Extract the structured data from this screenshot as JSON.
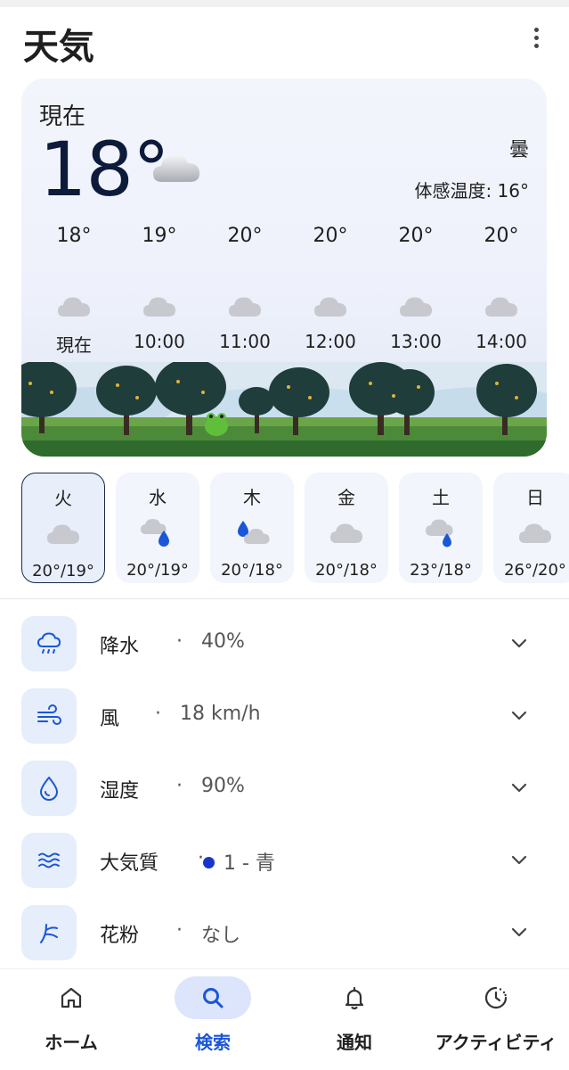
{
  "app": {
    "title": "天気"
  },
  "current": {
    "label": "現在",
    "temperature": "18°",
    "condition": "曇",
    "feels_like": "体感温度: 16°",
    "icon": "cloud-icon"
  },
  "hourly": [
    {
      "temp": "18°",
      "time": "現在",
      "icon": "cloud-icon"
    },
    {
      "temp": "19°",
      "time": "10:00",
      "icon": "cloud-icon"
    },
    {
      "temp": "20°",
      "time": "11:00",
      "icon": "cloud-icon"
    },
    {
      "temp": "20°",
      "time": "12:00",
      "icon": "cloud-icon"
    },
    {
      "temp": "20°",
      "time": "13:00",
      "icon": "cloud-icon"
    },
    {
      "temp": "20°",
      "time": "14:00",
      "icon": "cloud-icon"
    }
  ],
  "daily": [
    {
      "day": "火",
      "range": "20°/19°",
      "icon": "cloud-icon",
      "selected": true
    },
    {
      "day": "水",
      "range": "20°/19°",
      "icon": "cloud-rain-icon"
    },
    {
      "day": "木",
      "range": "20°/18°",
      "icon": "rain-cloud-icon"
    },
    {
      "day": "金",
      "range": "20°/18°",
      "icon": "cloud-icon"
    },
    {
      "day": "土",
      "range": "23°/18°",
      "icon": "cloud-rain-icon"
    },
    {
      "day": "日",
      "range": "26°/20°",
      "icon": "cloud-icon"
    }
  ],
  "details": {
    "dot": "·",
    "precipitation": {
      "label": "降水",
      "value": "40%",
      "icon": "rain-cloud-icon"
    },
    "wind": {
      "label": "風",
      "value": "18 km/h",
      "icon": "wind-icon"
    },
    "humidity": {
      "label": "湿度",
      "value": "90%",
      "icon": "droplet-icon"
    },
    "air_quality": {
      "label": "大気質",
      "value": "1 - 青",
      "icon": "air-waves-icon",
      "dot_color": "#1736c9"
    },
    "pollen": {
      "label": "花粉",
      "value": "なし",
      "icon": "pollen-icon"
    }
  },
  "bottom_nav": [
    {
      "label": "ホーム",
      "icon": "home-icon"
    },
    {
      "label": "検索",
      "icon": "search-icon",
      "active": true
    },
    {
      "label": "通知",
      "icon": "bell-icon"
    },
    {
      "label": "アクティビティ",
      "icon": "activity-icon"
    }
  ],
  "colors": {
    "accent": "#1a56d8",
    "icon_blue": "#1a56d8",
    "card_bg": "#eef1fb",
    "nav_active_bg": "#dce5fb"
  }
}
